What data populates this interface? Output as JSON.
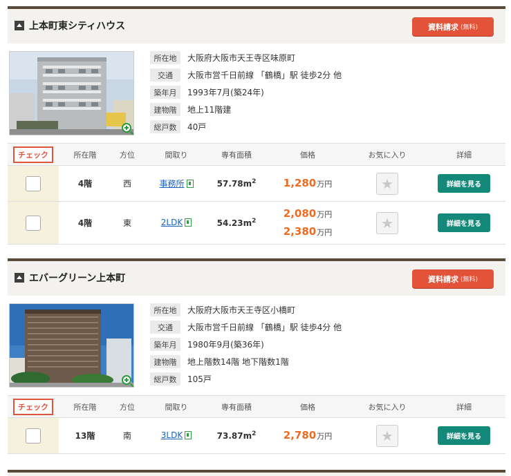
{
  "labels": {
    "request_btn": "資料請求",
    "request_free": "(無料)",
    "info_address": "所在地",
    "info_access": "交通",
    "info_built": "築年月",
    "info_floors": "建物階",
    "info_units": "総戸数",
    "col_check": "チェック",
    "col_floor": "所在階",
    "col_dir": "方位",
    "col_plan": "間取り",
    "col_area": "専有面積",
    "col_price": "価格",
    "col_fav": "お気に入り",
    "col_detail": "詳細",
    "detail_btn": "詳細を見る",
    "area_unit": "m",
    "area_sup": "2",
    "price_unit": "万円"
  },
  "properties": [
    {
      "name": "上本町東シティハウス",
      "address": "大阪府大阪市天王寺区味原町",
      "access": "大阪市営千日前線 「鶴橋」駅 徒歩2分 他",
      "built": "1993年7月(築24年)",
      "floors": "地上11階建",
      "units": "40戸",
      "rows": [
        {
          "floor": "4階",
          "dir": "西",
          "plan": "事務所",
          "area": "57.78",
          "prices": [
            "1,280"
          ]
        },
        {
          "floor": "4階",
          "dir": "東",
          "plan": "2LDK",
          "area": "54.23",
          "prices": [
            "2,080",
            "2,380"
          ]
        }
      ]
    },
    {
      "name": "エバーグリーン上本町",
      "address": "大阪府大阪市天王寺区小橋町",
      "access": "大阪市営千日前線 「鶴橋」駅 徒歩4分 他",
      "built": "1980年9月(築36年)",
      "floors": "地上階数14階 地下階数1階",
      "units": "105戸",
      "rows": [
        {
          "floor": "13階",
          "dir": "南",
          "plan": "3LDK",
          "area": "73.87",
          "prices": [
            "2,780"
          ]
        }
      ]
    }
  ],
  "colors": {
    "accent": "#e2533a",
    "price": "#f06a22",
    "detail": "#14897a",
    "check_bg": "#f6f1dc"
  },
  "icons": [
    "section-arrow-icon",
    "zoom-icon",
    "floorplan-icon",
    "star-icon"
  ]
}
